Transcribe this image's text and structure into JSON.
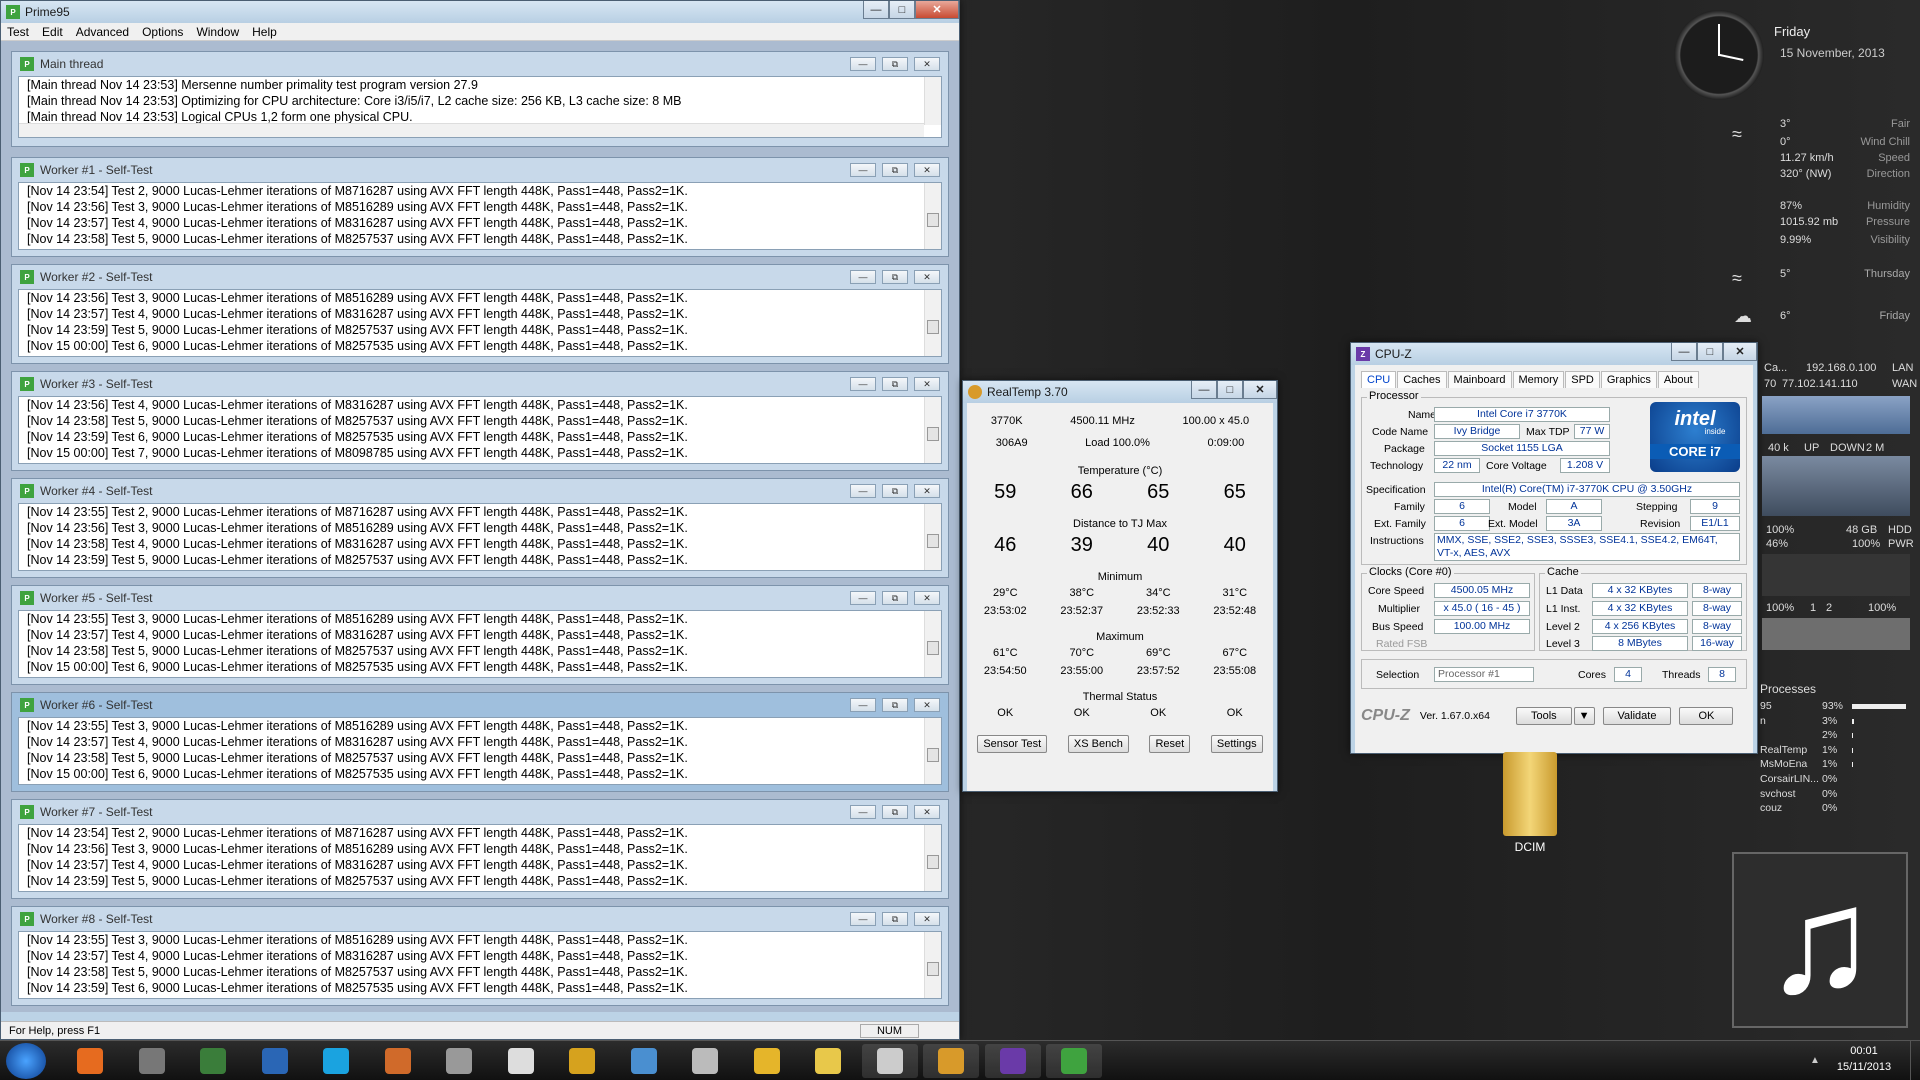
{
  "prime95": {
    "title": "Prime95",
    "menu": [
      "Test",
      "Edit",
      "Advanced",
      "Options",
      "Window",
      "Help"
    ],
    "main_thread": {
      "title": "Main thread",
      "lines": [
        "[Main thread Nov 14 23:53] Mersenne number primality test program version 27.9",
        "[Main thread Nov 14 23:53] Optimizing for CPU architecture: Core i3/i5/i7, L2 cache size: 256 KB, L3 cache size: 8 MB",
        "[Main thread Nov 14 23:53] Logical CPUs 1,2 form one physical CPU."
      ]
    },
    "workers": [
      {
        "title": "Worker #1 - Self-Test",
        "lines": [
          "[Nov 14 23:54] Test 2, 9000 Lucas-Lehmer iterations of M8716287 using AVX FFT length 448K, Pass1=448, Pass2=1K.",
          "[Nov 14 23:56] Test 3, 9000 Lucas-Lehmer iterations of M8516289 using AVX FFT length 448K, Pass1=448, Pass2=1K.",
          "[Nov 14 23:57] Test 4, 9000 Lucas-Lehmer iterations of M8316287 using AVX FFT length 448K, Pass1=448, Pass2=1K.",
          "[Nov 14 23:58] Test 5, 9000 Lucas-Lehmer iterations of M8257537 using AVX FFT length 448K, Pass1=448, Pass2=1K."
        ]
      },
      {
        "title": "Worker #2 - Self-Test",
        "lines": [
          "[Nov 14 23:56] Test 3, 9000 Lucas-Lehmer iterations of M8516289 using AVX FFT length 448K, Pass1=448, Pass2=1K.",
          "[Nov 14 23:57] Test 4, 9000 Lucas-Lehmer iterations of M8316287 using AVX FFT length 448K, Pass1=448, Pass2=1K.",
          "[Nov 14 23:59] Test 5, 9000 Lucas-Lehmer iterations of M8257537 using AVX FFT length 448K, Pass1=448, Pass2=1K.",
          "[Nov 15 00:00] Test 6, 9000 Lucas-Lehmer iterations of M8257535 using AVX FFT length 448K, Pass1=448, Pass2=1K."
        ]
      },
      {
        "title": "Worker #3 - Self-Test",
        "lines": [
          "[Nov 14 23:56] Test 4, 9000 Lucas-Lehmer iterations of M8316287 using AVX FFT length 448K, Pass1=448, Pass2=1K.",
          "[Nov 14 23:58] Test 5, 9000 Lucas-Lehmer iterations of M8257537 using AVX FFT length 448K, Pass1=448, Pass2=1K.",
          "[Nov 14 23:59] Test 6, 9000 Lucas-Lehmer iterations of M8257535 using AVX FFT length 448K, Pass1=448, Pass2=1K.",
          "[Nov 15 00:00] Test 7, 9000 Lucas-Lehmer iterations of M8098785 using AVX FFT length 448K, Pass1=448, Pass2=1K."
        ]
      },
      {
        "title": "Worker #4 - Self-Test",
        "lines": [
          "[Nov 14 23:55] Test 2, 9000 Lucas-Lehmer iterations of M8716287 using AVX FFT length 448K, Pass1=448, Pass2=1K.",
          "[Nov 14 23:56] Test 3, 9000 Lucas-Lehmer iterations of M8516289 using AVX FFT length 448K, Pass1=448, Pass2=1K.",
          "[Nov 14 23:58] Test 4, 9000 Lucas-Lehmer iterations of M8316287 using AVX FFT length 448K, Pass1=448, Pass2=1K.",
          "[Nov 14 23:59] Test 5, 9000 Lucas-Lehmer iterations of M8257537 using AVX FFT length 448K, Pass1=448, Pass2=1K."
        ]
      },
      {
        "title": "Worker #5 - Self-Test",
        "lines": [
          "[Nov 14 23:55] Test 3, 9000 Lucas-Lehmer iterations of M8516289 using AVX FFT length 448K, Pass1=448, Pass2=1K.",
          "[Nov 14 23:57] Test 4, 9000 Lucas-Lehmer iterations of M8316287 using AVX FFT length 448K, Pass1=448, Pass2=1K.",
          "[Nov 14 23:58] Test 5, 9000 Lucas-Lehmer iterations of M8257537 using AVX FFT length 448K, Pass1=448, Pass2=1K.",
          "[Nov 15 00:00] Test 6, 9000 Lucas-Lehmer iterations of M8257535 using AVX FFT length 448K, Pass1=448, Pass2=1K."
        ]
      },
      {
        "title": "Worker #6 - Self-Test",
        "lines": [
          "[Nov 14 23:55] Test 3, 9000 Lucas-Lehmer iterations of M8516289 using AVX FFT length 448K, Pass1=448, Pass2=1K.",
          "[Nov 14 23:57] Test 4, 9000 Lucas-Lehmer iterations of M8316287 using AVX FFT length 448K, Pass1=448, Pass2=1K.",
          "[Nov 14 23:58] Test 5, 9000 Lucas-Lehmer iterations of M8257537 using AVX FFT length 448K, Pass1=448, Pass2=1K.",
          "[Nov 15 00:00] Test 6, 9000 Lucas-Lehmer iterations of M8257535 using AVX FFT length 448K, Pass1=448, Pass2=1K."
        ]
      },
      {
        "title": "Worker #7 - Self-Test",
        "lines": [
          "[Nov 14 23:54] Test 2, 9000 Lucas-Lehmer iterations of M8716287 using AVX FFT length 448K, Pass1=448, Pass2=1K.",
          "[Nov 14 23:56] Test 3, 9000 Lucas-Lehmer iterations of M8516289 using AVX FFT length 448K, Pass1=448, Pass2=1K.",
          "[Nov 14 23:57] Test 4, 9000 Lucas-Lehmer iterations of M8316287 using AVX FFT length 448K, Pass1=448, Pass2=1K.",
          "[Nov 14 23:59] Test 5, 9000 Lucas-Lehmer iterations of M8257537 using AVX FFT length 448K, Pass1=448, Pass2=1K."
        ]
      },
      {
        "title": "Worker #8 - Self-Test",
        "lines": [
          "[Nov 14 23:55] Test 3, 9000 Lucas-Lehmer iterations of M8516289 using AVX FFT length 448K, Pass1=448, Pass2=1K.",
          "[Nov 14 23:57] Test 4, 9000 Lucas-Lehmer iterations of M8316287 using AVX FFT length 448K, Pass1=448, Pass2=1K.",
          "[Nov 14 23:58] Test 5, 9000 Lucas-Lehmer iterations of M8257537 using AVX FFT length 448K, Pass1=448, Pass2=1K.",
          "[Nov 14 23:59] Test 6, 9000 Lucas-Lehmer iterations of M8257535 using AVX FFT length 448K, Pass1=448, Pass2=1K."
        ]
      }
    ],
    "status_left": "For Help, press F1",
    "status_num": "NUM"
  },
  "realtemp": {
    "title": "RealTemp 3.70",
    "row1": [
      "3770K",
      "4500.11 MHz",
      "100.00 x 45.0"
    ],
    "row2": [
      "306A9",
      "Load 100.0%",
      "0:09:00"
    ],
    "temp_label": "Temperature (°C)",
    "temps": [
      "59",
      "66",
      "65",
      "65"
    ],
    "dist_label": "Distance to TJ Max",
    "dists": [
      "46",
      "39",
      "40",
      "40"
    ],
    "min_label": "Minimum",
    "min_vals": [
      "29°C",
      "38°C",
      "34°C",
      "31°C"
    ],
    "min_times": [
      "23:53:02",
      "23:52:37",
      "23:52:33",
      "23:52:48"
    ],
    "max_label": "Maximum",
    "max_vals": [
      "61°C",
      "70°C",
      "69°C",
      "67°C"
    ],
    "max_times": [
      "23:54:50",
      "23:55:00",
      "23:57:52",
      "23:55:08"
    ],
    "thermal_label": "Thermal Status",
    "thermal": [
      "OK",
      "OK",
      "OK",
      "OK"
    ],
    "buttons": [
      "Sensor Test",
      "XS Bench",
      "Reset",
      "Settings"
    ]
  },
  "cpuz": {
    "title": "CPU-Z",
    "tabs": [
      "CPU",
      "Caches",
      "Mainboard",
      "Memory",
      "SPD",
      "Graphics",
      "About"
    ],
    "processor_label": "Processor",
    "name_label": "Name",
    "name": "Intel Core i7 3770K",
    "codename_label": "Code Name",
    "codename": "Ivy Bridge",
    "maxtdp_label": "Max TDP",
    "maxtdp": "77 W",
    "package_label": "Package",
    "package": "Socket 1155 LGA",
    "tech_label": "Technology",
    "tech": "22 nm",
    "corev_label": "Core Voltage",
    "corev": "1.208 V",
    "spec_label": "Specification",
    "spec": "Intel(R) Core(TM) i7-3770K CPU @ 3.50GHz",
    "family_label": "Family",
    "family": "6",
    "model_label": "Model",
    "model": "A",
    "stepping_label": "Stepping",
    "stepping": "9",
    "extfamily_label": "Ext. Family",
    "extfamily": "6",
    "extmodel_label": "Ext. Model",
    "extmodel": "3A",
    "revision_label": "Revision",
    "revision": "E1/L1",
    "instr_label": "Instructions",
    "instr1": "MMX, SSE, SSE2, SSE3, SSSE3, SSE4.1, SSE4.2, EM64T,",
    "instr2": "VT-x, AES, AVX",
    "intel_inside": "intel",
    "intel_sub": "inside",
    "intel_core": "CORE i7",
    "clocks_label": "Clocks (Core #0)",
    "corespeed_label": "Core Speed",
    "corespeed": "4500.05 MHz",
    "multiplier_label": "Multiplier",
    "multiplier": "x 45.0 ( 16 - 45 )",
    "busspeed_label": "Bus Speed",
    "busspeed": "100.00 MHz",
    "ratedfsb_label": "Rated FSB",
    "cache_label": "Cache",
    "l1d_label": "L1 Data",
    "l1d": "4 x 32 KBytes",
    "l1d_way": "8-way",
    "l1i_label": "L1 Inst.",
    "l1i": "4 x 32 KBytes",
    "l1i_way": "8-way",
    "l2_label": "Level 2",
    "l2": "4 x 256 KBytes",
    "l2_way": "8-way",
    "l3_label": "Level 3",
    "l3": "8 MBytes",
    "l3_way": "16-way",
    "selection_label": "Selection",
    "selection": "Processor #1",
    "cores_label": "Cores",
    "cores": "4",
    "threads_label": "Threads",
    "threads": "8",
    "brand": "CPU-Z",
    "version": "Ver. 1.67.0.x64",
    "tools": "Tools",
    "validate": "Validate",
    "ok": "OK"
  },
  "gadgets": {
    "day": "Friday",
    "date": "15 November, 2013",
    "weather": [
      {
        "v": "3°",
        "l": "Fair"
      },
      {
        "v": "0°",
        "l": "Wind Chill"
      },
      {
        "v": "11.27 km/h",
        "l": "Speed"
      },
      {
        "v": "320° (NW)",
        "l": "Direction"
      },
      {
        "v": "87%",
        "l": "Humidity"
      },
      {
        "v": "1015.92 mb",
        "l": "Pressure"
      },
      {
        "v": "9.99%",
        "l": "Visibility"
      }
    ],
    "forecast": [
      {
        "v": "5°",
        "l": "Thursday"
      },
      {
        "v": "6°",
        "l": "Friday"
      }
    ],
    "net_left": "Ca...",
    "lan_ip": "192.168.0.100",
    "lan": "LAN",
    "net_num": "70",
    "wan_ip": "77.102.141.110",
    "wan": "WAN",
    "up_val": "40 k",
    "up": "UP",
    "down": "DOWN",
    "down_val": "2 M",
    "mem_pct": "100%",
    "mem_size": "48 GB",
    "hdd": "HDD",
    "cpu_pct": "46%",
    "pwr_pct": "100%",
    "pwr": "PWR",
    "core_a": "100%",
    "core1": "1",
    "core2": "2",
    "core_b": "100%",
    "processes_label": "Processes",
    "processes": [
      {
        "n": "95",
        "p": "93%"
      },
      {
        "n": "n",
        "p": "3%"
      },
      {
        "n": "",
        "p": "2%"
      },
      {
        "n": "RealTemp",
        "p": "1%"
      },
      {
        "n": "MsMoEna",
        "p": "1%"
      },
      {
        "n": "CorsairLIN...",
        "p": "0%"
      },
      {
        "n": "svchost",
        "p": "0%"
      },
      {
        "n": "couz",
        "p": "0%"
      }
    ]
  },
  "desktop_icon": "DCIM",
  "clock": {
    "time": "00:01",
    "date": "15/11/2013"
  }
}
